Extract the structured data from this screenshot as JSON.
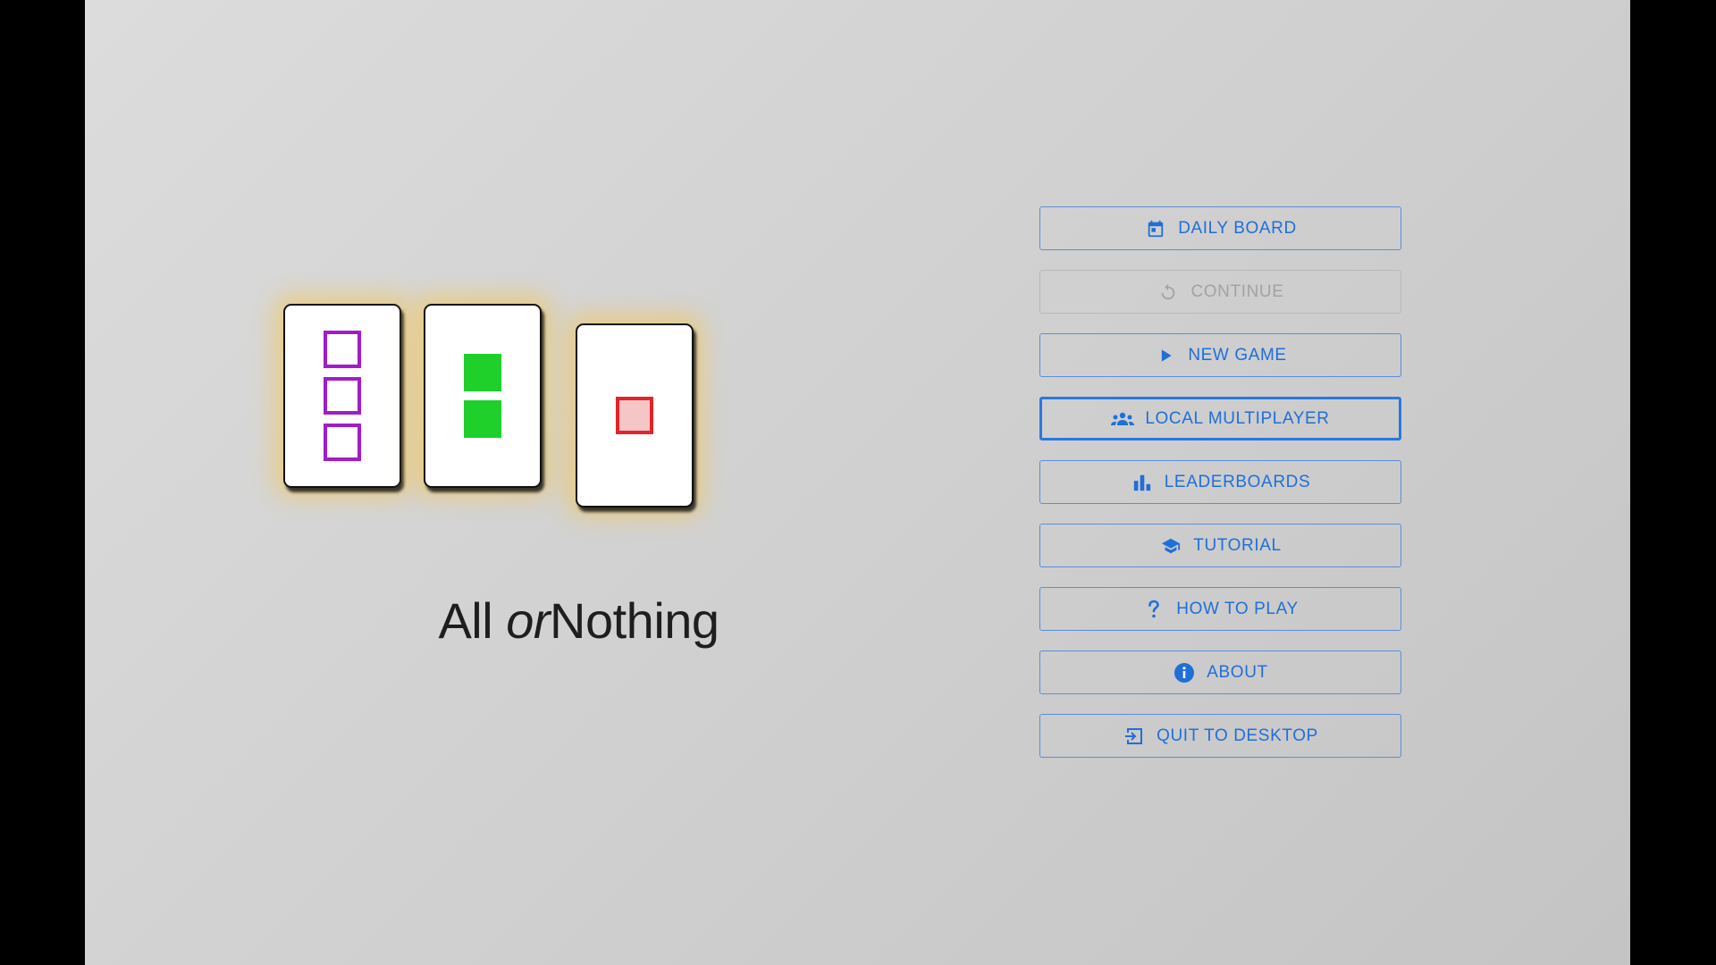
{
  "title": {
    "part1": "All",
    "part2": "or",
    "part3": "Nothing"
  },
  "cards": [
    {
      "shape_count": 3,
      "fill": "outline",
      "color": "#a21cc9",
      "highlighted": true
    },
    {
      "shape_count": 2,
      "fill": "filled",
      "color": "#1fcf2a",
      "highlighted": true
    },
    {
      "shape_count": 1,
      "fill": "shaded",
      "color": "#e5232a",
      "shade_color": "#f5c6c6",
      "highlighted": true
    }
  ],
  "menu": {
    "items": [
      {
        "label": "DAILY BOARD",
        "icon": "calendar-icon",
        "state": "enabled"
      },
      {
        "label": "CONTINUE",
        "icon": "restart-icon",
        "state": "disabled"
      },
      {
        "label": "NEW GAME",
        "icon": "play-icon",
        "state": "enabled"
      },
      {
        "label": "LOCAL MULTIPLAYER",
        "icon": "group-icon",
        "state": "focused"
      },
      {
        "label": "LEADERBOARDS",
        "icon": "bar-chart-icon",
        "state": "enabled"
      },
      {
        "label": "TUTORIAL",
        "icon": "graduation-cap-icon",
        "state": "enabled"
      },
      {
        "label": "HOW TO PLAY",
        "icon": "question-icon",
        "state": "enabled"
      },
      {
        "label": "ABOUT",
        "icon": "info-icon",
        "state": "enabled"
      },
      {
        "label": "QUIT TO DESKTOP",
        "icon": "exit-icon",
        "state": "enabled"
      }
    ]
  },
  "colors": {
    "accent": "#1f6fd9",
    "disabled": "#a3a3a3",
    "card_glow": "#f2c85a"
  }
}
